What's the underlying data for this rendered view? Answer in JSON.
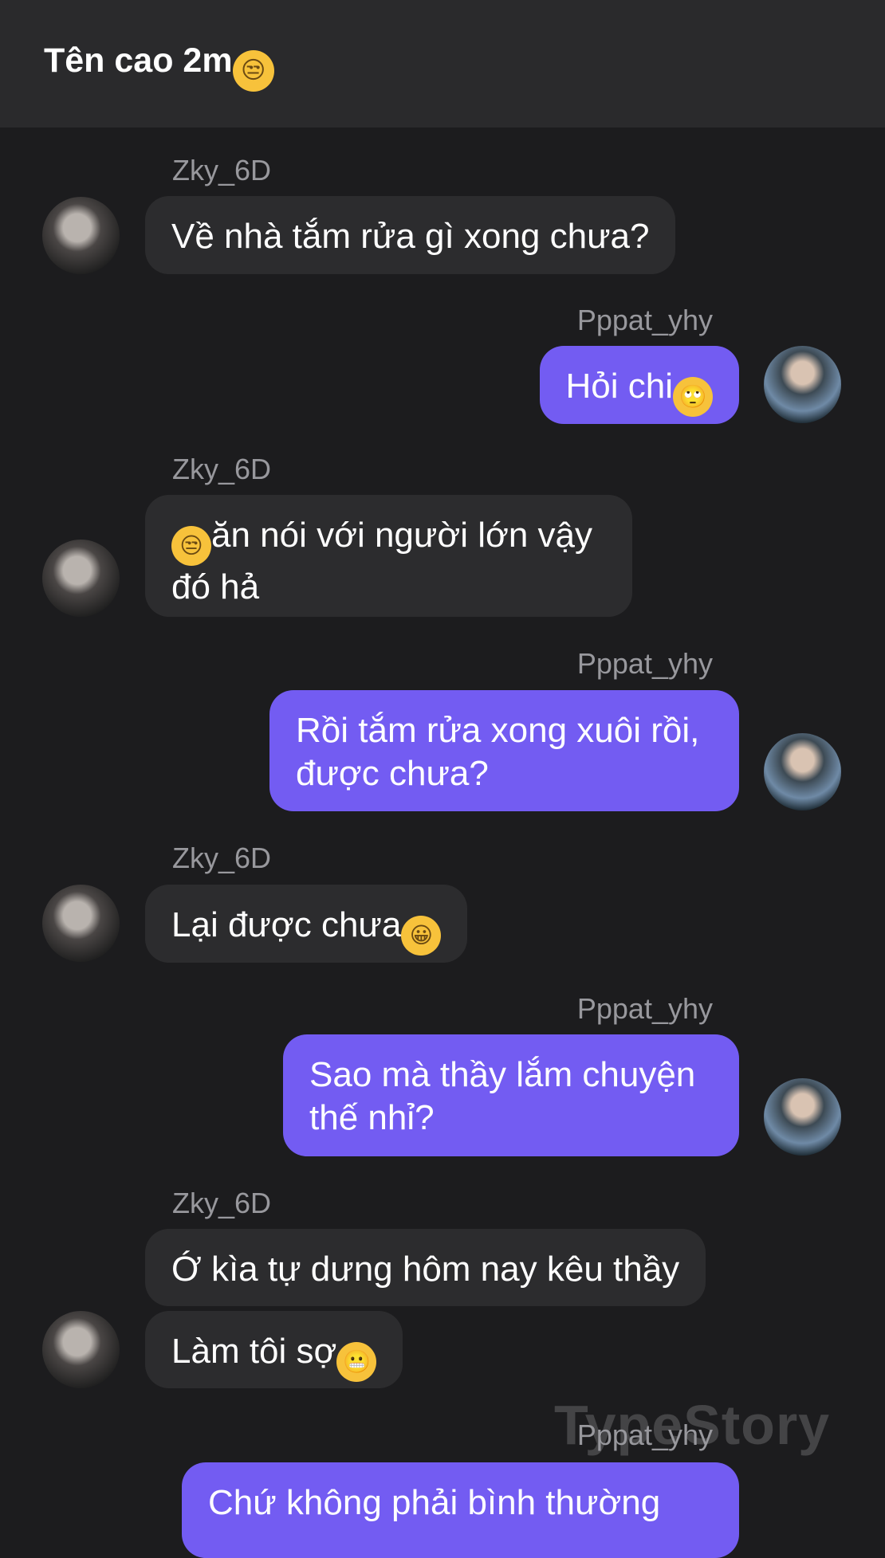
{
  "header": {
    "title": "Tên cao 2m",
    "title_emoji": "😒"
  },
  "users": {
    "them": "Zky_6D",
    "me": "Pppat_yhy"
  },
  "messages": [
    {
      "text": "Về nhà tắm rửa gì xong chưa?"
    },
    {
      "text": "Hỏi chi",
      "emoji": "🙄"
    },
    {
      "emoji": "😒",
      "line1": "ăn nói với người lớn vậy",
      "line2": "đó hả"
    },
    {
      "line1": "Rồi tắm rửa xong xuôi rồi,",
      "line2": "được chưa?"
    },
    {
      "text": "Lại được chưa",
      "emoji": "😀"
    },
    {
      "line1": "Sao mà thầy lắm chuyện",
      "line2": "thế nhỉ?"
    },
    {
      "text": "Ớ kìa tự dưng hôm nay kêu thầy"
    },
    {
      "text": "Làm tôi sợ",
      "emoji": "😬"
    },
    {
      "text": "Chứ không phải bình thường"
    }
  ],
  "watermark": "TypeStory"
}
